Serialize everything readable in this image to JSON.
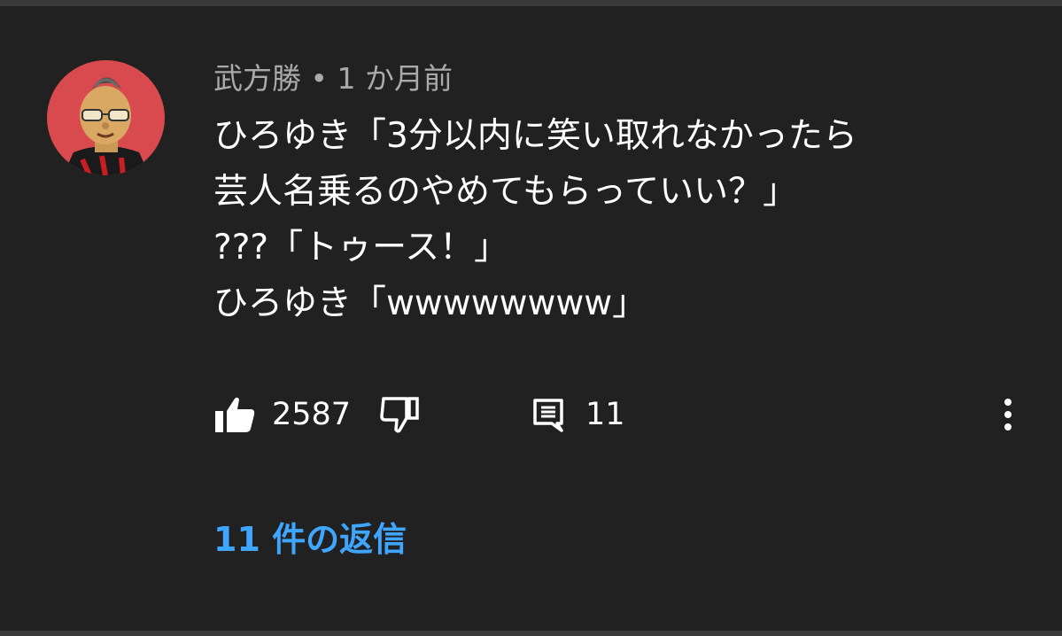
{
  "comment": {
    "author": "武方勝",
    "separator": "•",
    "timestamp": "1 か月前",
    "lines": [
      "ひろゆき「3分以内に笑い取れなかったら",
      "芸人名乗るのやめてもらっていい？」",
      "???「トゥース！」",
      "ひろゆき「wwwwwwww」"
    ],
    "like_count": "2587",
    "reply_count": "11",
    "replies_link": "11 件の返信"
  },
  "icons": {
    "like": "thumbs-up-filled-icon",
    "dislike": "thumbs-down-outline-icon",
    "reply": "comment-icon",
    "more": "vertical-ellipsis-icon"
  },
  "colors": {
    "background": "#212121",
    "text": "#ffffff",
    "meta": "#aaaaaa",
    "link": "#3ea6ff",
    "avatar_bg": "#d84a4e"
  }
}
